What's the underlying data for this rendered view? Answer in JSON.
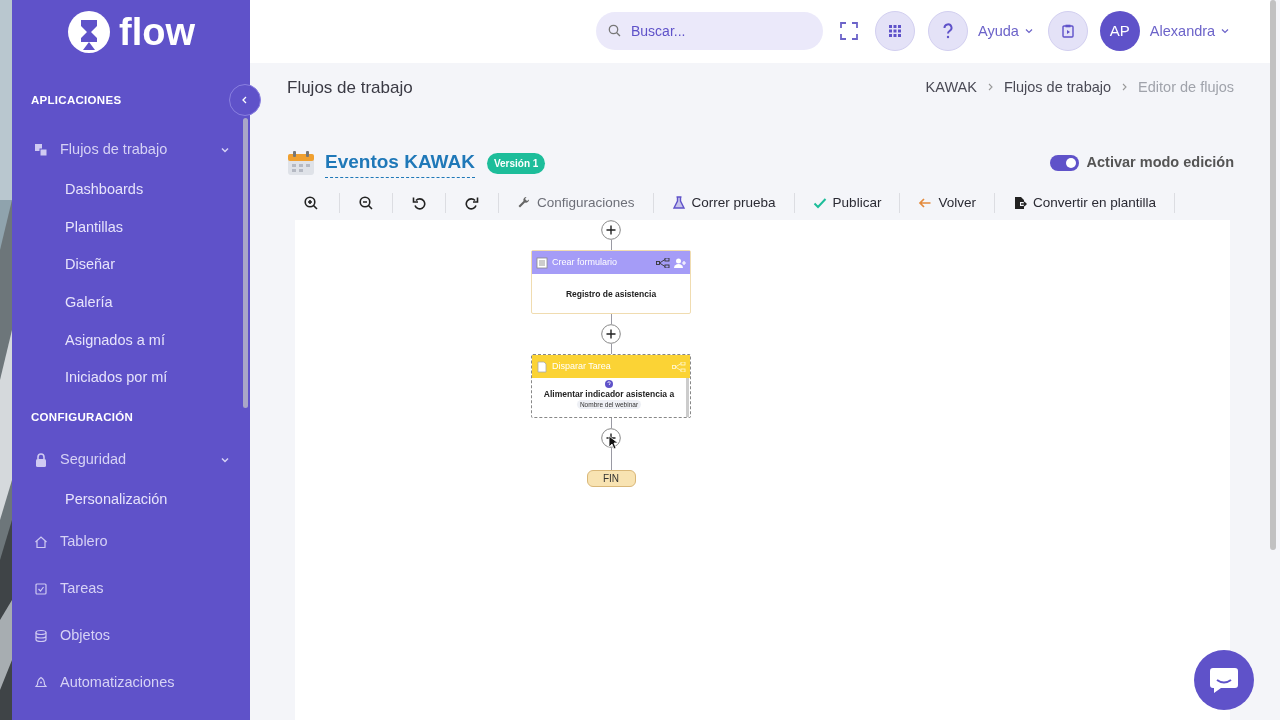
{
  "brand": {
    "name": "flow"
  },
  "sidebar": {
    "sections": [
      {
        "heading": "APLICACIONES",
        "items": [
          {
            "label": "Flujos de trabajo",
            "expanded": true,
            "children": [
              {
                "label": "Dashboards"
              },
              {
                "label": "Plantillas"
              },
              {
                "label": "Diseñar"
              },
              {
                "label": "Galería"
              },
              {
                "label": "Asignados a mí"
              },
              {
                "label": "Iniciados por mí"
              }
            ]
          }
        ]
      },
      {
        "heading": "CONFIGURACIÓN",
        "items": [
          {
            "label": "Seguridad",
            "expanded": true,
            "children": [
              {
                "label": "Personalización"
              }
            ]
          },
          {
            "label": "Tablero"
          },
          {
            "label": "Tareas"
          },
          {
            "label": "Objetos"
          },
          {
            "label": "Automatizaciones"
          }
        ]
      }
    ]
  },
  "header": {
    "search": {
      "placeholder": "Buscar..."
    },
    "help": "Ayuda",
    "avatar": "AP",
    "user": "Alexandra"
  },
  "page": {
    "title": "Flujos de trabajo",
    "breadcrumbs": [
      {
        "label": "KAWAK",
        "current": false
      },
      {
        "label": "Flujos de trabajo",
        "current": false
      },
      {
        "label": "Editor de flujos",
        "current": true
      }
    ]
  },
  "flow": {
    "title": "Eventos KAWAK",
    "version": "Versión 1",
    "edit_toggle": {
      "label": "Activar modo edición",
      "on": true
    },
    "toolbar": [
      {
        "label": "Configuraciones",
        "disabled": true
      },
      {
        "label": "Correr prueba",
        "disabled": false
      },
      {
        "label": "Publicar",
        "disabled": false
      },
      {
        "label": "Volver",
        "disabled": false
      },
      {
        "label": "Convertir en plantilla",
        "disabled": false
      }
    ],
    "nodes": [
      {
        "kind": "form",
        "header": "Crear formulario",
        "body": "Registro de asistencia",
        "color": "#a59cf7",
        "selected": false
      },
      {
        "kind": "task",
        "header": "Disparar Tarea",
        "body": "Alimentar indicador asistencia a",
        "tag": "Nombre del webinar",
        "color": "#fbd335",
        "selected": true
      }
    ],
    "end": "FIN"
  }
}
